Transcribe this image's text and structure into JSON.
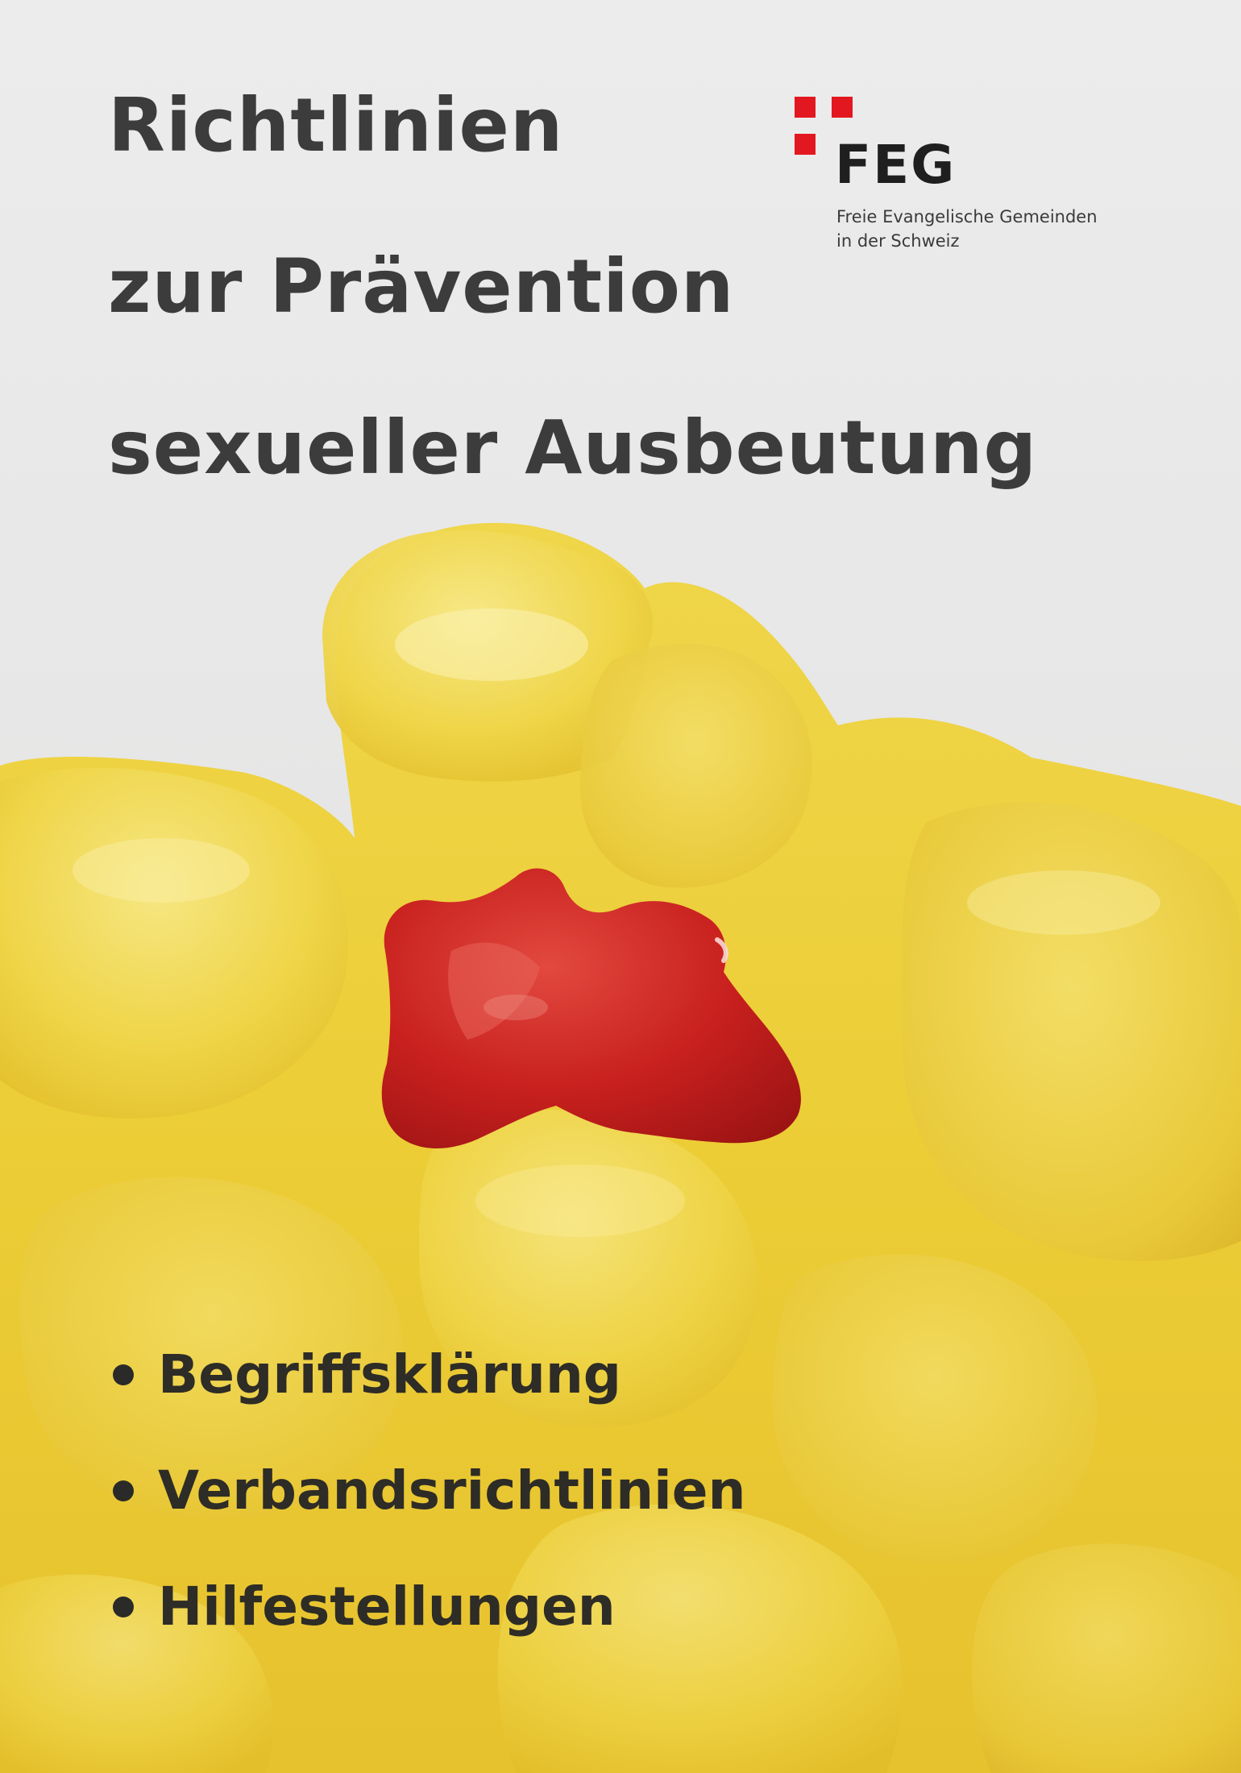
{
  "cover": {
    "title_lines": [
      "Richtlinien",
      "zur Prävention",
      "sexueller Ausbeutung"
    ],
    "logo": {
      "wordmark": "FEG",
      "subtitle_lines": [
        "Freie Evangelische Gemeinden",
        "in der Schweiz"
      ],
      "mark_color": "#e3171f"
    },
    "bullets": [
      "Begriffsklärung",
      "Verbandsrichtlinien",
      "Hilfestellungen"
    ],
    "colors": {
      "title": "#3c3c3c",
      "bullet_text": "#2e2c26",
      "gummy_yellow": "#eed13a",
      "gummy_red": "#c51a1c"
    }
  }
}
